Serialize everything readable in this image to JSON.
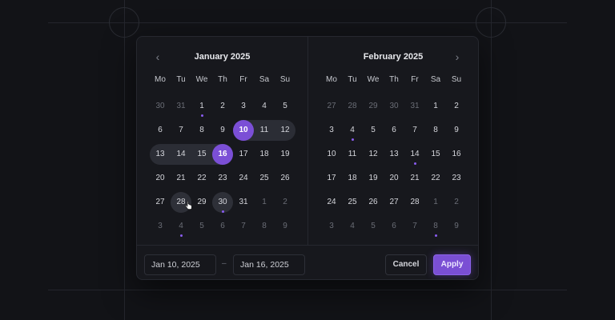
{
  "calendar": {
    "left": {
      "title": "January 2025",
      "prev_label": "‹",
      "weekdays": [
        "Mo",
        "Tu",
        "We",
        "Th",
        "Fr",
        "Sa",
        "Su"
      ],
      "days": [
        {
          "d": "30",
          "out": true
        },
        {
          "d": "31",
          "out": true
        },
        {
          "d": "1",
          "dot": true
        },
        {
          "d": "2"
        },
        {
          "d": "3"
        },
        {
          "d": "4"
        },
        {
          "d": "5"
        },
        {
          "d": "6"
        },
        {
          "d": "7"
        },
        {
          "d": "8"
        },
        {
          "d": "9"
        },
        {
          "d": "10",
          "selected": true,
          "range": "start"
        },
        {
          "d": "11",
          "range": "mid"
        },
        {
          "d": "12",
          "range": "end"
        },
        {
          "d": "13",
          "range": "start"
        },
        {
          "d": "14",
          "range": "mid"
        },
        {
          "d": "15",
          "range": "mid"
        },
        {
          "d": "16",
          "selected": true,
          "range": "end"
        },
        {
          "d": "17"
        },
        {
          "d": "18"
        },
        {
          "d": "19"
        },
        {
          "d": "20"
        },
        {
          "d": "21"
        },
        {
          "d": "22"
        },
        {
          "d": "23"
        },
        {
          "d": "24"
        },
        {
          "d": "25"
        },
        {
          "d": "26"
        },
        {
          "d": "27"
        },
        {
          "d": "28",
          "hover": true
        },
        {
          "d": "29"
        },
        {
          "d": "30",
          "hover": true,
          "dot": true
        },
        {
          "d": "31"
        },
        {
          "d": "1",
          "out": true
        },
        {
          "d": "2",
          "out": true
        },
        {
          "d": "3",
          "out": true
        },
        {
          "d": "4",
          "out": true,
          "dot": true
        },
        {
          "d": "5",
          "out": true
        },
        {
          "d": "6",
          "out": true
        },
        {
          "d": "7",
          "out": true
        },
        {
          "d": "8",
          "out": true
        },
        {
          "d": "9",
          "out": true
        }
      ]
    },
    "right": {
      "title": "February 2025",
      "next_label": "›",
      "weekdays": [
        "Mo",
        "Tu",
        "We",
        "Th",
        "Fr",
        "Sa",
        "Su"
      ],
      "days": [
        {
          "d": "27",
          "out": true
        },
        {
          "d": "28",
          "out": true
        },
        {
          "d": "29",
          "out": true
        },
        {
          "d": "30",
          "out": true
        },
        {
          "d": "31",
          "out": true
        },
        {
          "d": "1"
        },
        {
          "d": "2"
        },
        {
          "d": "3"
        },
        {
          "d": "4",
          "dot": true
        },
        {
          "d": "5"
        },
        {
          "d": "6"
        },
        {
          "d": "7"
        },
        {
          "d": "8"
        },
        {
          "d": "9"
        },
        {
          "d": "10"
        },
        {
          "d": "11"
        },
        {
          "d": "12"
        },
        {
          "d": "13"
        },
        {
          "d": "14",
          "dot": true
        },
        {
          "d": "15"
        },
        {
          "d": "16"
        },
        {
          "d": "17"
        },
        {
          "d": "18"
        },
        {
          "d": "19"
        },
        {
          "d": "20"
        },
        {
          "d": "21"
        },
        {
          "d": "22"
        },
        {
          "d": "23"
        },
        {
          "d": "24"
        },
        {
          "d": "25"
        },
        {
          "d": "26"
        },
        {
          "d": "27"
        },
        {
          "d": "28"
        },
        {
          "d": "1",
          "out": true
        },
        {
          "d": "2",
          "out": true
        },
        {
          "d": "3",
          "out": true
        },
        {
          "d": "4",
          "out": true
        },
        {
          "d": "5",
          "out": true
        },
        {
          "d": "6",
          "out": true
        },
        {
          "d": "7",
          "out": true
        },
        {
          "d": "8",
          "out": true,
          "dot": true
        },
        {
          "d": "9",
          "out": true
        }
      ]
    }
  },
  "footer": {
    "start_date": "Jan 10, 2025",
    "separator": "–",
    "end_date": "Jan 16, 2025",
    "cancel_label": "Cancel",
    "apply_label": "Apply"
  },
  "colors": {
    "accent": "#7b4fd6",
    "range_bg": "#2b2d35",
    "event_dot": "#8a5cf0"
  }
}
